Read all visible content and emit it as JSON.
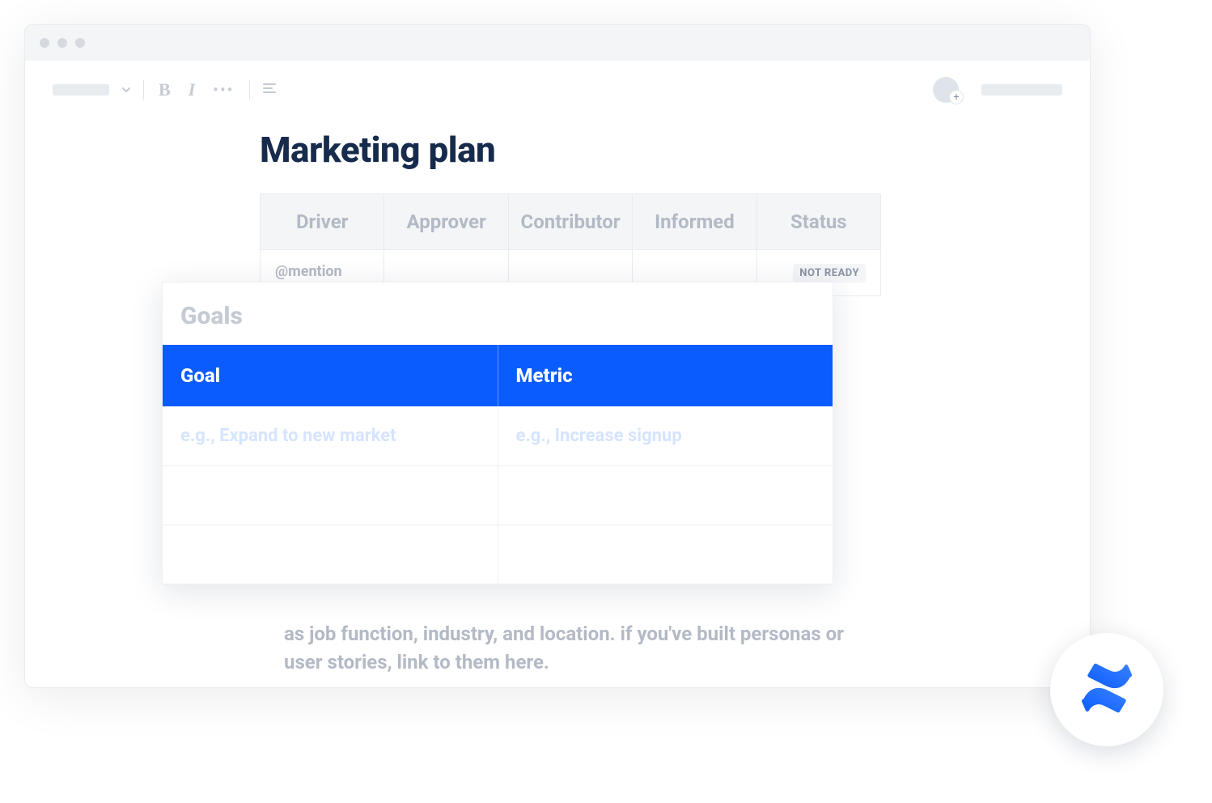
{
  "page": {
    "title": "Marketing plan"
  },
  "toolbar": {
    "bold": "B",
    "italic": "I",
    "more": "•••"
  },
  "avatar": {
    "plus": "+"
  },
  "dacis": {
    "headers": [
      "Driver",
      "Approver",
      "Contributor",
      "Informed",
      "Status"
    ],
    "row": {
      "driver": "@mention",
      "approver": "",
      "contributor": "",
      "informed": "",
      "status_badge": "NOT READY"
    }
  },
  "goals": {
    "title": "Goals",
    "headers": [
      "Goal",
      "Metric"
    ],
    "rows": [
      {
        "goal": "e.g., Expand to new market",
        "metric": "e.g., Increase signup"
      },
      {
        "goal": "",
        "metric": ""
      },
      {
        "goal": "",
        "metric": ""
      }
    ]
  },
  "body_text": "as job function, industry, and location. if you've built personas or user stories, link to them here.",
  "colors": {
    "accent": "#0b5cff",
    "muted": "#b3bac5",
    "heading": "#172b4d"
  }
}
